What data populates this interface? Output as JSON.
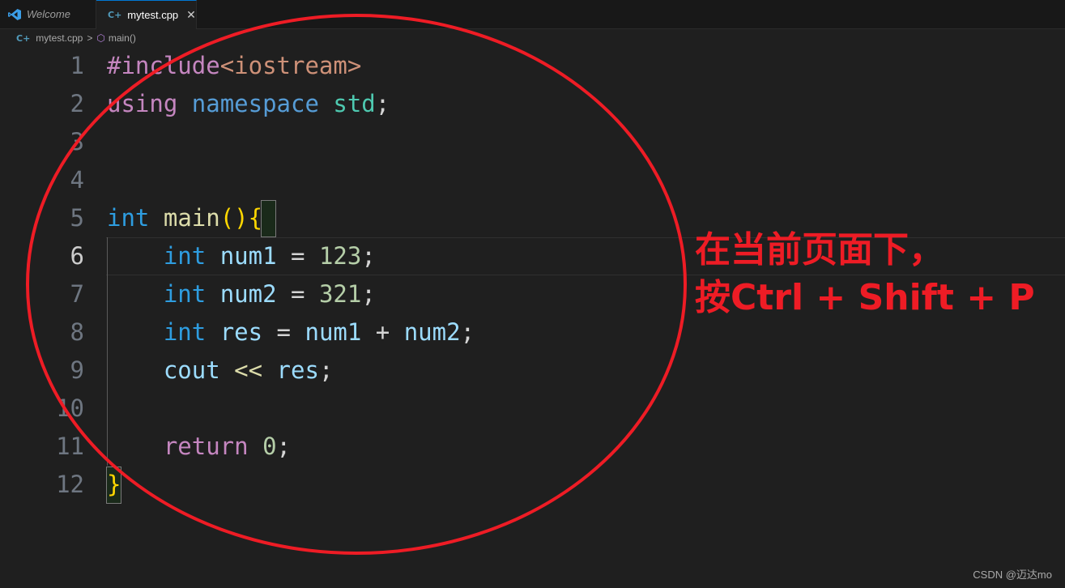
{
  "tabs": [
    {
      "label": "Welcome",
      "icon": "vscode-icon",
      "active": false
    },
    {
      "label": "mytest.cpp",
      "icon": "cpp-file-icon",
      "active": true,
      "close": "✕"
    }
  ],
  "breadcrumb": {
    "file": "mytest.cpp",
    "separator": ">",
    "symbol": "main()"
  },
  "editor": {
    "current_line": 6,
    "lines": [
      {
        "n": "1",
        "tokens": [
          [
            "k-pre",
            "#include"
          ],
          [
            "k-str",
            "<iostream>"
          ]
        ]
      },
      {
        "n": "2",
        "tokens": [
          [
            "k-pre",
            "using"
          ],
          [
            "k-op",
            " "
          ],
          [
            "k-ns",
            "namespace"
          ],
          [
            "k-op",
            " "
          ],
          [
            "k-std",
            "std"
          ],
          [
            "k-op",
            ";"
          ]
        ]
      },
      {
        "n": "3",
        "tokens": []
      },
      {
        "n": "4",
        "tokens": []
      },
      {
        "n": "5",
        "tokens": [
          [
            "k-type",
            "int"
          ],
          [
            "k-op",
            " "
          ],
          [
            "k-fn",
            "main"
          ],
          [
            "k-br",
            "(){"
          ]
        ]
      },
      {
        "n": "6",
        "tokens": [
          [
            "k-op",
            "    "
          ],
          [
            "k-type",
            "int"
          ],
          [
            "k-op",
            " "
          ],
          [
            "k-var",
            "num1"
          ],
          [
            "k-op",
            " = "
          ],
          [
            "k-num",
            "123"
          ],
          [
            "k-op",
            ";"
          ]
        ]
      },
      {
        "n": "7",
        "tokens": [
          [
            "k-op",
            "    "
          ],
          [
            "k-type",
            "int"
          ],
          [
            "k-op",
            " "
          ],
          [
            "k-var",
            "num2"
          ],
          [
            "k-op",
            " = "
          ],
          [
            "k-num",
            "321"
          ],
          [
            "k-op",
            ";"
          ]
        ]
      },
      {
        "n": "8",
        "tokens": [
          [
            "k-op",
            "    "
          ],
          [
            "k-type",
            "int"
          ],
          [
            "k-op",
            " "
          ],
          [
            "k-var",
            "res"
          ],
          [
            "k-op",
            " = "
          ],
          [
            "k-var",
            "num1"
          ],
          [
            "k-op",
            " + "
          ],
          [
            "k-var",
            "num2"
          ],
          [
            "k-op",
            ";"
          ]
        ]
      },
      {
        "n": "9",
        "tokens": [
          [
            "k-op",
            "    "
          ],
          [
            "k-var",
            "cout"
          ],
          [
            "k-op",
            " "
          ],
          [
            "k-sh",
            "<<"
          ],
          [
            "k-op",
            " "
          ],
          [
            "k-var",
            "res"
          ],
          [
            "k-op",
            ";"
          ]
        ]
      },
      {
        "n": "10",
        "tokens": []
      },
      {
        "n": "11",
        "tokens": [
          [
            "k-op",
            "    "
          ],
          [
            "k-ret",
            "return"
          ],
          [
            "k-op",
            " "
          ],
          [
            "k-num",
            "0"
          ],
          [
            "k-op",
            ";"
          ]
        ]
      },
      {
        "n": "12",
        "tokens": [
          [
            "k-br",
            "}"
          ]
        ]
      }
    ]
  },
  "annotation": {
    "line1": "在当前页面下，",
    "line2": "按Ctrl + Shift + P",
    "color": "#ee1c25"
  },
  "watermark": "CSDN @迈达mo"
}
